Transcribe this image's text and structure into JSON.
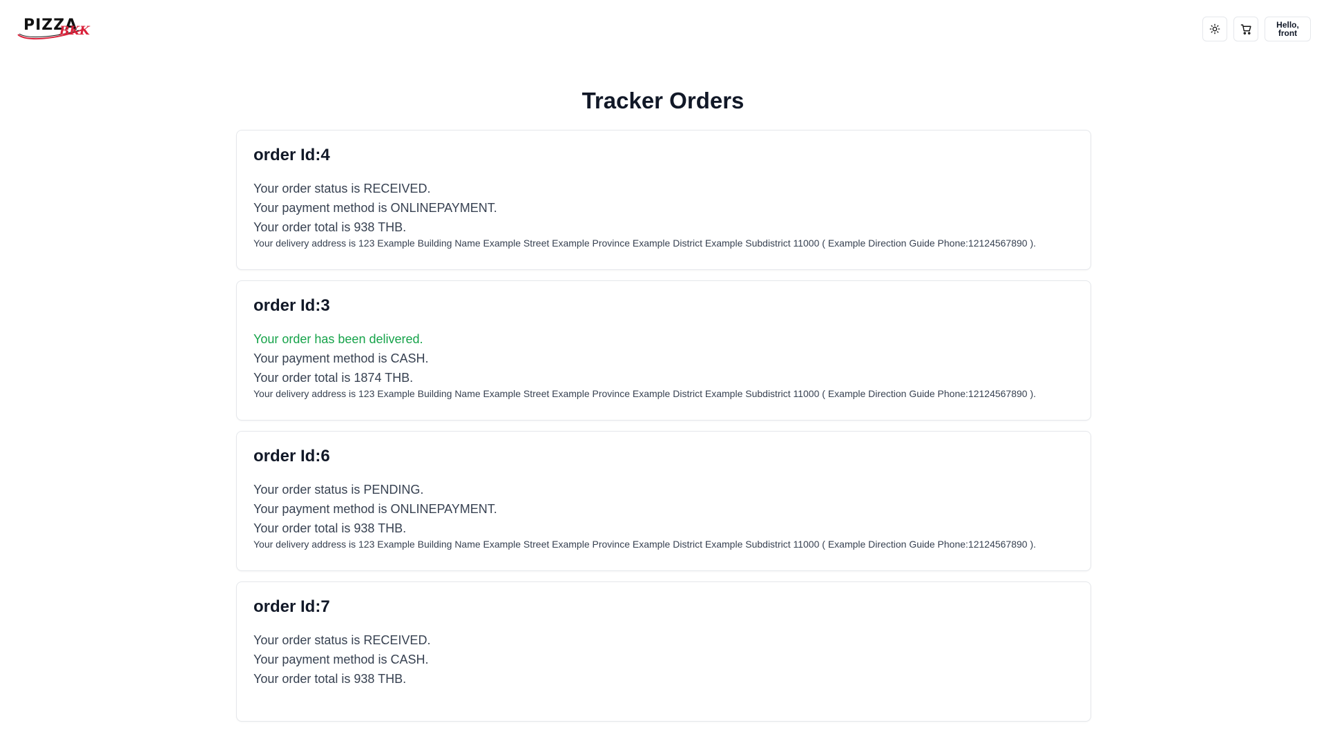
{
  "header": {
    "logo_text": "PIZZA",
    "logo_sub": "BKK",
    "theme_icon": "sun-icon",
    "cart_icon": "cart-icon",
    "user_greeting": "Hello,",
    "user_name": "front"
  },
  "page": {
    "title": "Tracker Orders"
  },
  "colors": {
    "delivered": "#16a34a",
    "brand_red": "#d9213a"
  },
  "orders": [
    {
      "title": "order Id:4",
      "status": "Your order status is RECEIVED.",
      "payment": "Your payment method is ONLINEPAYMENT.",
      "total": "Your order total is 938 THB.",
      "address": "Your delivery address is 123 Example Building Name Example Street Example Province Example District Example Subdistrict 11000 ( Example Direction Guide Phone:12124567890 )."
    },
    {
      "title": "order Id:3",
      "status": "Your order has been delivered.",
      "payment": "Your payment method is CASH.",
      "total": "Your order total is 1874 THB.",
      "address": "Your delivery address is 123 Example Building Name Example Street Example Province Example District Example Subdistrict 11000 ( Example Direction Guide Phone:12124567890 )."
    },
    {
      "title": "order Id:6",
      "status": "Your order status is PENDING.",
      "payment": "Your payment method is ONLINEPAYMENT.",
      "total": "Your order total is 938 THB.",
      "address": "Your delivery address is 123 Example Building Name Example Street Example Province Example District Example Subdistrict 11000 ( Example Direction Guide Phone:12124567890 )."
    },
    {
      "title": "order Id:7",
      "status": "Your order status is RECEIVED.",
      "payment": "Your payment method is CASH.",
      "total": "Your order total is 938 THB."
    }
  ]
}
